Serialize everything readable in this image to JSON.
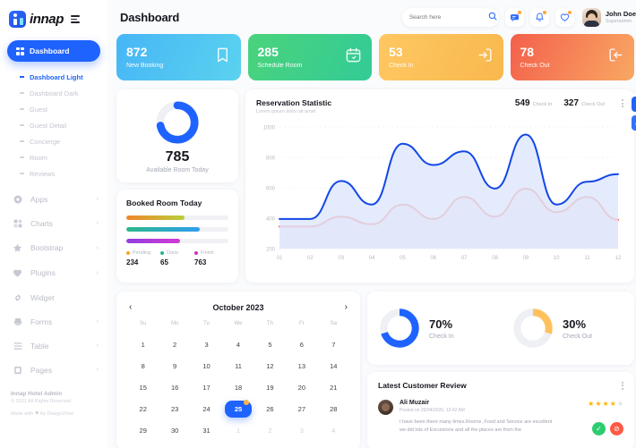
{
  "brand": {
    "name": "innap",
    "logo_icon": "innap-logo-icon",
    "menu_icon": "hamburger-icon"
  },
  "sidebar": {
    "active_item": {
      "label": "Dashboard",
      "icon": "grid-icon"
    },
    "submenu": [
      {
        "label": "Dashboard Light",
        "active": true
      },
      {
        "label": "Dashboard Dark",
        "active": false
      },
      {
        "label": "Guest",
        "active": false
      },
      {
        "label": "Guest Detail",
        "active": false
      },
      {
        "label": "Concierge",
        "active": false
      },
      {
        "label": "Room",
        "active": false
      },
      {
        "label": "Reviews",
        "active": false
      }
    ],
    "items": [
      {
        "label": "Apps",
        "icon": "apps-icon",
        "arrow": "›"
      },
      {
        "label": "Charts",
        "icon": "charts-icon",
        "arrow": "›"
      },
      {
        "label": "Bootstrap",
        "icon": "star-icon",
        "arrow": "›"
      },
      {
        "label": "Plugins",
        "icon": "heart-icon",
        "arrow": "›"
      },
      {
        "label": "Widget",
        "icon": "gear-icon",
        "arrow": ""
      },
      {
        "label": "Forms",
        "icon": "forms-icon",
        "arrow": "›"
      },
      {
        "label": "Table",
        "icon": "table-icon",
        "arrow": "›"
      },
      {
        "label": "Pages",
        "icon": "pages-icon",
        "arrow": "›"
      }
    ],
    "footer": {
      "line1": "Innap Hotel Admin",
      "line2": "© 2021 All Rights Reserved",
      "line3_pre": "Made with",
      "line3_heart": "♥",
      "line3_post": "by DesignZone"
    }
  },
  "header": {
    "title": "Dashboard",
    "search": {
      "placeholder": "Search here",
      "value": "",
      "icon": "search-icon"
    },
    "icons": [
      {
        "name": "message-icon",
        "glyph": "✉",
        "badge": true
      },
      {
        "name": "bell-icon",
        "glyph": "🔔",
        "badge": true
      },
      {
        "name": "heart-icon",
        "glyph": "♡",
        "badge": true
      }
    ],
    "user": {
      "name": "John Doe",
      "role": "Superadmin",
      "avatar": "user-avatar"
    }
  },
  "stats": [
    {
      "value": "872",
      "label": "New Booking",
      "icon": "bookmark-icon",
      "color_from": "#4fb9f7",
      "color_to": "#5ad0f0"
    },
    {
      "value": "285",
      "label": "Schedule Room",
      "icon": "calendar-icon",
      "color_from": "#4bd37b",
      "color_to": "#35cc95"
    },
    {
      "value": "53",
      "label": "Check In",
      "icon": "login-icon",
      "color_from": "#ffc45e",
      "color_to": "#f9b94f"
    },
    {
      "value": "78",
      "label": "Check Out",
      "icon": "logout-icon",
      "color_from": "#f4664f",
      "color_to": "#f8a05d"
    }
  ],
  "available_room": {
    "value": "785",
    "label": "Available Room Today",
    "percent": 72,
    "color": "#1f63ff",
    "track": "#eef0f4"
  },
  "booked_room": {
    "title": "Booked Room Today",
    "bars": [
      {
        "percent": 57,
        "from": "#f0852c",
        "to": "#b8cf3a"
      },
      {
        "percent": 72,
        "from": "#2db88a",
        "to": "#2f9ef0"
      },
      {
        "percent": 53,
        "from": "#8f3ee0",
        "to": "#d23ad2"
      }
    ],
    "legend": [
      {
        "name": "Pending",
        "value": "234",
        "color": "#f5a623"
      },
      {
        "name": "Done",
        "value": "65",
        "color": "#21b890"
      },
      {
        "name": "Finish",
        "value": "763",
        "color": "#d12ed1"
      }
    ]
  },
  "reservation": {
    "title": "Reservation Statistic",
    "subtitle": "Lorem ipsum dolor sit amet",
    "kpis": [
      {
        "value": "549",
        "label": "Check In"
      },
      {
        "value": "327",
        "label": "Check Out"
      }
    ],
    "menu_icon": "more-vertical-icon"
  },
  "chart_data": {
    "type": "area",
    "title": "Reservation Statistic",
    "subtitle": "Lorem ipsum dolor sit amet",
    "x": [
      "01",
      "02",
      "03",
      "04",
      "05",
      "06",
      "07",
      "08",
      "09",
      "10",
      "11",
      "12"
    ],
    "xlabel": "",
    "ylabel": "",
    "ylim": [
      200,
      1000
    ],
    "yticks": [
      200,
      400,
      600,
      800,
      1000
    ],
    "grid": true,
    "legend": "none",
    "series": [
      {
        "name": "Check In",
        "color": "#1447e8",
        "fill": "#dfe8fb",
        "values": [
          395,
          395,
          645,
          490,
          890,
          750,
          840,
          595,
          950,
          490,
          640,
          690
        ]
      },
      {
        "name": "Check Out",
        "color": "#f4402a",
        "fill": "#eadfe8",
        "values": [
          345,
          345,
          410,
          360,
          490,
          395,
          540,
          410,
          595,
          440,
          540,
          390
        ]
      }
    ]
  },
  "calendar": {
    "month": "October 2023",
    "prev_icon": "chevron-left-icon",
    "next_icon": "chevron-right-icon",
    "dow": [
      "Su",
      "Mo",
      "Tu",
      "We",
      "Th",
      "Fr",
      "Sa"
    ],
    "weeks": [
      [
        {
          "d": "1"
        },
        {
          "d": "2"
        },
        {
          "d": "3"
        },
        {
          "d": "4"
        },
        {
          "d": "5"
        },
        {
          "d": "6"
        },
        {
          "d": "7"
        }
      ],
      [
        {
          "d": "8"
        },
        {
          "d": "9"
        },
        {
          "d": "10"
        },
        {
          "d": "11"
        },
        {
          "d": "12"
        },
        {
          "d": "13"
        },
        {
          "d": "14"
        }
      ],
      [
        {
          "d": "15"
        },
        {
          "d": "16"
        },
        {
          "d": "17"
        },
        {
          "d": "18"
        },
        {
          "d": "19"
        },
        {
          "d": "20"
        },
        {
          "d": "21"
        }
      ],
      [
        {
          "d": "22"
        },
        {
          "d": "23"
        },
        {
          "d": "24"
        },
        {
          "d": "25",
          "selected": true,
          "dot": true
        },
        {
          "d": "26"
        },
        {
          "d": "27"
        },
        {
          "d": "28"
        }
      ],
      [
        {
          "d": "29"
        },
        {
          "d": "30"
        },
        {
          "d": "31"
        },
        {
          "d": "1",
          "mute": true
        },
        {
          "d": "2",
          "mute": true
        },
        {
          "d": "3",
          "mute": true
        },
        {
          "d": "4",
          "mute": true
        }
      ]
    ]
  },
  "percent_cards": [
    {
      "value": "70%",
      "label": "Check In",
      "percent": 70,
      "color": "#1f63ff",
      "track": "#eef0f4"
    },
    {
      "value": "30%",
      "label": "Check Out",
      "percent": 30,
      "color": "#ffc15e",
      "track": "#eef0f4"
    }
  ],
  "review": {
    "title": "Latest Customer Review",
    "menu_icon": "more-vertical-icon",
    "author": "Ali Muzair",
    "posted": "Posted on 26/04/2020, 12:42 AM",
    "text": "I have been there many times.Rooms ,Food and Service are excellent we did lots of Excursions and all the places are from the",
    "stars_filled": 4,
    "stars_total": 5,
    "approve_icon": "check-circle-icon",
    "reject_icon": "block-circle-icon"
  },
  "float_buttons": [
    {
      "name": "settings-button",
      "icon": "gear-icon",
      "glyph": "✸"
    },
    {
      "name": "theme-button",
      "icon": "droplet-icon",
      "glyph": "◑"
    }
  ]
}
